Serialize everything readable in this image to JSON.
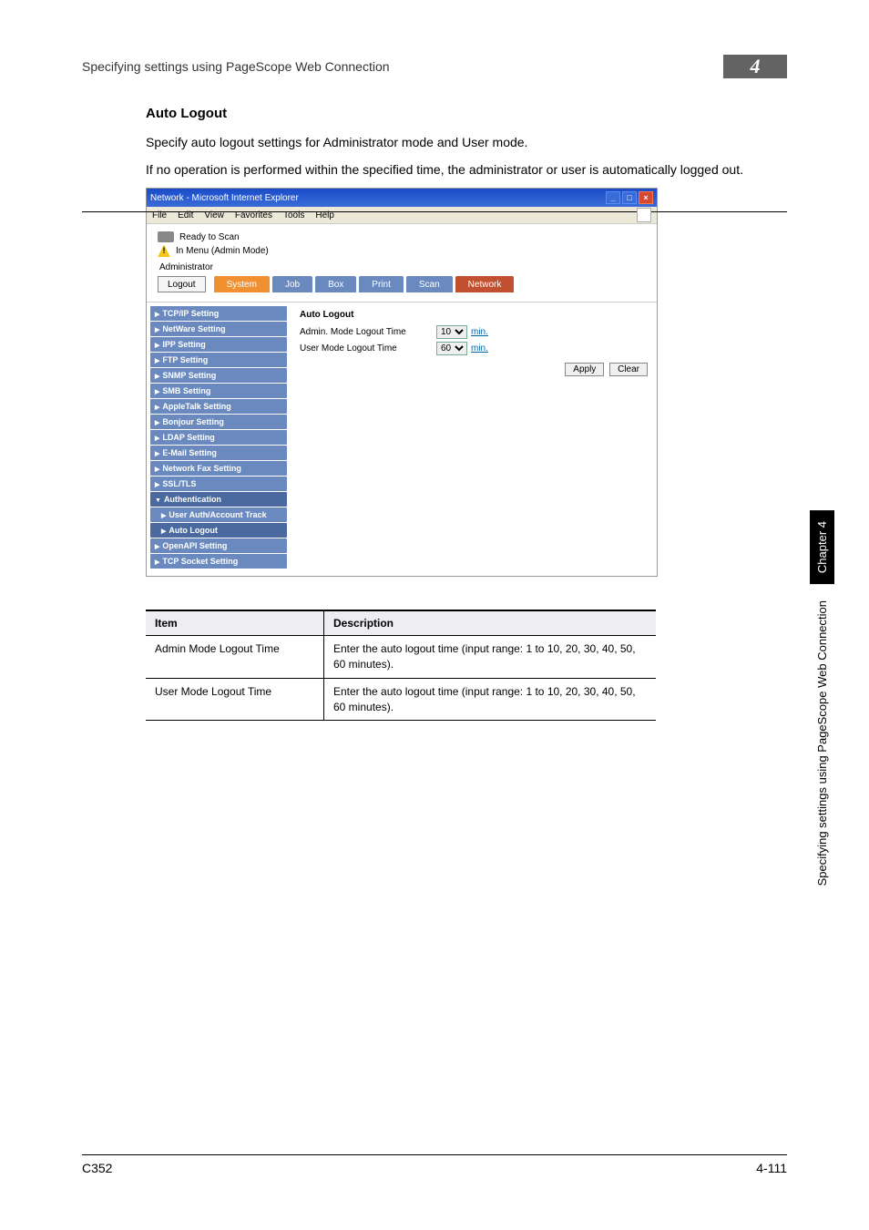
{
  "header": {
    "running_head": "Specifying settings using PageScope Web Connection",
    "chapter_number": "4"
  },
  "section": {
    "heading": "Auto Logout",
    "para1": "Specify auto logout settings for Administrator mode and User mode.",
    "para2": "If no operation is performed within the specified time, the administrator or user is automatically logged out."
  },
  "screenshot": {
    "titlebar": "Network - Microsoft Internet Explorer",
    "menu": {
      "file": "File",
      "edit": "Edit",
      "view": "View",
      "favorites": "Favorites",
      "tools": "Tools",
      "help": "Help"
    },
    "status1": "Ready to Scan",
    "status2": "In Menu (Admin Mode)",
    "admin_label": "Administrator",
    "logout_button": "Logout",
    "tabs": {
      "system": "System",
      "job": "Job",
      "box": "Box",
      "print": "Print",
      "scan": "Scan",
      "network": "Network"
    },
    "side_items": [
      "TCP/IP Setting",
      "NetWare Setting",
      "IPP Setting",
      "FTP Setting",
      "SNMP Setting",
      "SMB Setting",
      "AppleTalk Setting",
      "Bonjour Setting",
      "LDAP Setting",
      "E-Mail Setting",
      "Network Fax Setting",
      "SSL/TLS",
      "Authentication",
      "User Auth/Account Track",
      "Auto Logout",
      "OpenAPI Setting",
      "TCP Socket Setting"
    ],
    "main_heading": "Auto Logout",
    "row_admin_label": "Admin. Mode Logout Time",
    "row_user_label": "User Mode Logout Time",
    "admin_value": "10",
    "user_value": "60",
    "unit": "min.",
    "apply": "Apply",
    "clear": "Clear"
  },
  "table": {
    "h_item": "Item",
    "h_desc": "Description",
    "rows": [
      {
        "item": "Admin Mode Logout Time",
        "desc": "Enter the auto logout time (input range: 1 to 10, 20, 30, 40, 50, 60 minutes)."
      },
      {
        "item": "User Mode Logout Time",
        "desc": "Enter the auto logout time (input range: 1 to 10, 20, 30, 40, 50, 60 minutes)."
      }
    ]
  },
  "sidetab": {
    "chapter": "Chapter 4",
    "text": "Specifying settings using PageScope Web Connection"
  },
  "footer": {
    "model": "C352",
    "page": "4-111"
  }
}
